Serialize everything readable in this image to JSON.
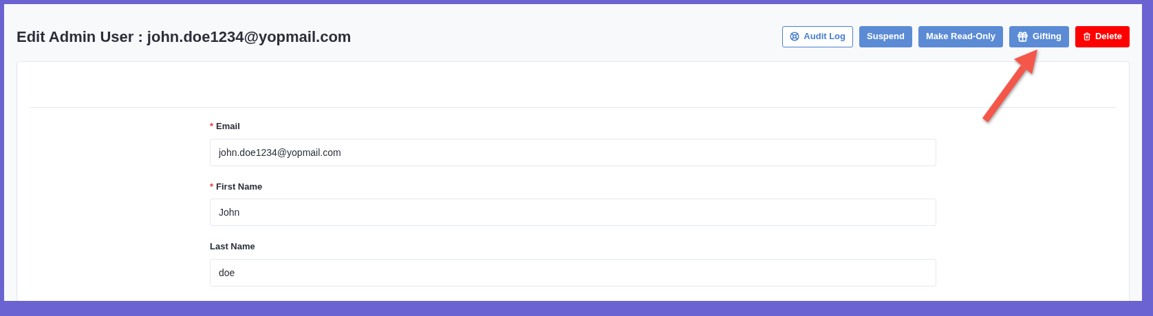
{
  "page_title": "Edit Admin User : john.doe1234@yopmail.com",
  "required_marker": "*",
  "actions": [
    {
      "label": "Audit Log",
      "kind": "outline"
    },
    {
      "label": "Suspend",
      "kind": "primary"
    },
    {
      "label": "Make Read-Only",
      "kind": "primary"
    },
    {
      "label": "Gifting",
      "kind": "primary"
    },
    {
      "label": "Delete",
      "kind": "danger"
    }
  ],
  "fields": [
    {
      "label": "Email",
      "required": true,
      "value": "john.doe1234@yopmail.com"
    },
    {
      "label": "First Name",
      "required": true,
      "value": "John"
    },
    {
      "label": "Last Name",
      "required": false,
      "value": "doe"
    }
  ]
}
